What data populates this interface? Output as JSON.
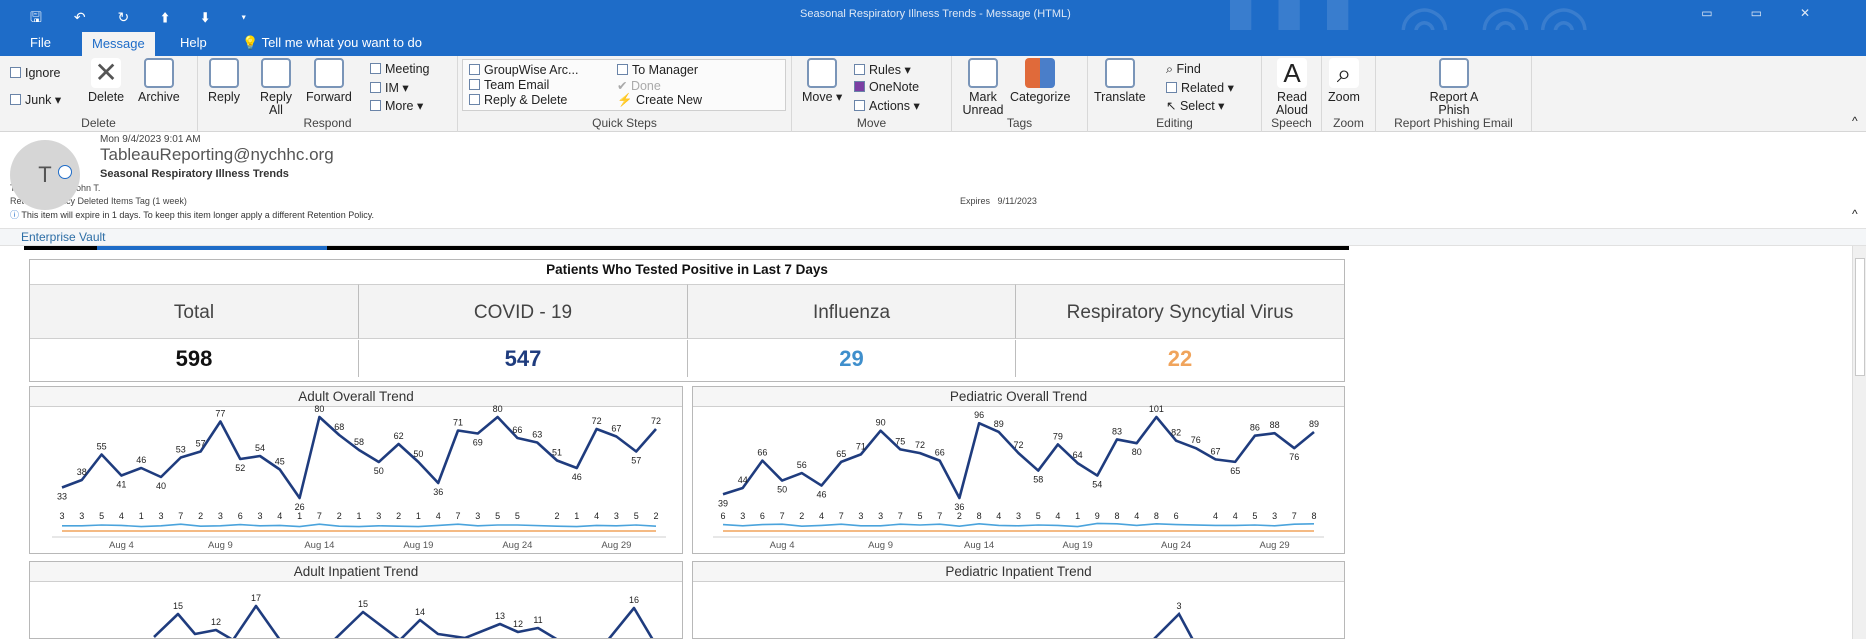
{
  "titlebar": {
    "title": "Seasonal Respiratory Illness Trends  -  Message (HTML)"
  },
  "tabs": [
    "File",
    "Message",
    "Help"
  ],
  "tell_me": "Tell me what you want to do",
  "ribbon": {
    "delete": {
      "ignore": "Ignore",
      "junk": "Junk",
      "delete": "Delete",
      "archive": "Archive",
      "label": "Delete"
    },
    "respond": {
      "reply": "Reply",
      "reply_all": "Reply All",
      "forward": "Forward",
      "meeting": "Meeting",
      "im": "IM",
      "more": "More",
      "label": "Respond"
    },
    "quick_steps": {
      "items": [
        "GroupWise Arc...",
        "To Manager",
        "Team Email",
        "Done",
        "Reply & Delete",
        "Create New"
      ],
      "label": "Quick Steps"
    },
    "move": {
      "move": "Move",
      "rules": "Rules",
      "onenote": "OneNote",
      "actions": "Actions",
      "label": "Move"
    },
    "tags": {
      "mark_unread": "Mark Unread",
      "categorize": "Categorize",
      "label": "Tags"
    },
    "editing": {
      "translate": "Translate",
      "find": "Find",
      "related": "Related",
      "select": "Select",
      "label": "Editing"
    },
    "speech": {
      "read_aloud": "Read Aloud",
      "label": "Speech"
    },
    "zoom": {
      "zoom": "Zoom",
      "label": "Zoom"
    },
    "phish": {
      "report": "Report A Phish",
      "label": "Report Phishing Email"
    }
  },
  "message": {
    "avatar": "T",
    "date": "Mon 9/4/2023 9:01 AM",
    "from": "TableauReporting@nychhc.org",
    "subject": "Seasonal Respiratory Illness Trends",
    "to_label": "To",
    "to": "Pellicone, John T.",
    "retention": "Retention Policy   Deleted Items Tag (1 week)",
    "expires_label": "Expires",
    "expires": "9/11/2023",
    "info": "This item will expire in 1 days. To keep this item longer apply a different Retention Policy."
  },
  "vault": "Enterprise Vault",
  "summary": {
    "title": "Patients Who Tested Positive in Last 7 Days",
    "columns": [
      {
        "label": "Total",
        "value": "598",
        "color": "#111111"
      },
      {
        "label": "COVID - 19",
        "value": "547",
        "color": "#1f3c7e"
      },
      {
        "label": "Influenza",
        "value": "29",
        "color": "#3f8fcc"
      },
      {
        "label": "Respiratory Syncytial Virus",
        "value": "22",
        "color": "#f0a45c"
      }
    ]
  },
  "chart_data": [
    {
      "type": "line",
      "title": "Adult Overall Trend",
      "x_ticks": [
        "Aug 4",
        "Aug 9",
        "Aug 14",
        "Aug 19",
        "Aug 24",
        "Aug 29"
      ],
      "series": [
        {
          "color": "#1f3c7e",
          "values": [
            33,
            38,
            55,
            41,
            46,
            40,
            53,
            57,
            77,
            52,
            54,
            45,
            26,
            80,
            68,
            58,
            50,
            62,
            50,
            36,
            71,
            69,
            80,
            66,
            63,
            51,
            46,
            72,
            67,
            57,
            72
          ]
        },
        {
          "color": "#4aa3dc",
          "values": [
            3,
            3,
            5,
            4,
            1,
            3,
            7,
            2,
            3,
            6,
            3,
            4,
            1,
            7,
            2,
            1,
            3,
            2,
            1,
            4,
            7,
            3,
            5,
            5,
            null,
            2,
            1,
            4,
            3,
            5,
            2
          ]
        }
      ]
    },
    {
      "type": "line",
      "title": "Pediatric Overall Trend",
      "x_ticks": [
        "Aug 4",
        "Aug 9",
        "Aug 14",
        "Aug 19",
        "Aug 24",
        "Aug 29"
      ],
      "series": [
        {
          "color": "#1f3c7e",
          "values": [
            39,
            44,
            66,
            50,
            56,
            46,
            65,
            71,
            90,
            75,
            72,
            66,
            36,
            96,
            89,
            72,
            58,
            79,
            64,
            54,
            83,
            80,
            101,
            82,
            76,
            67,
            65,
            86,
            88,
            76,
            89
          ]
        },
        {
          "color": "#4aa3dc",
          "values": [
            6,
            3,
            6,
            7,
            2,
            4,
            7,
            3,
            3,
            7,
            5,
            7,
            2,
            8,
            4,
            3,
            5,
            4,
            1,
            9,
            8,
            4,
            8,
            6,
            null,
            4,
            4,
            5,
            3,
            7,
            8
          ]
        }
      ]
    },
    {
      "type": "line",
      "title": "Adult Inpatient Trend",
      "labels": [
        12,
        15,
        12,
        17,
        15,
        14,
        13,
        12,
        11,
        16
      ]
    },
    {
      "type": "line",
      "title": "Pediatric Inpatient Trend",
      "labels": [
        3
      ]
    }
  ]
}
